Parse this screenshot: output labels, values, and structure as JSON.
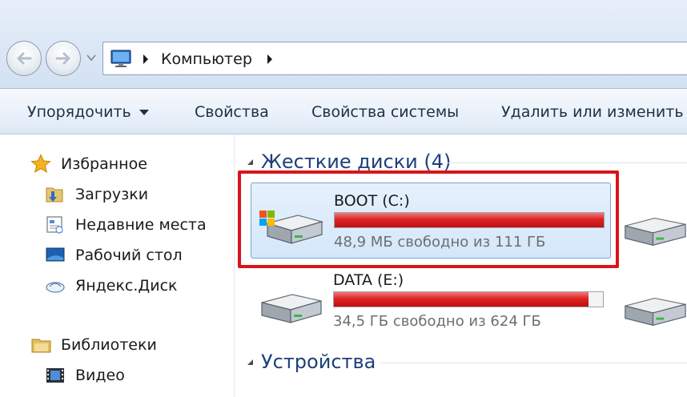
{
  "address": {
    "crumb": "Компьютер"
  },
  "toolbar": {
    "organize_label": "Упорядочить",
    "properties_label": "Свойства",
    "system_properties_label": "Свойства системы",
    "uninstall_label": "Удалить или изменить п"
  },
  "navigation": {
    "favorites_label": "Избранное",
    "favorites_items": [
      "Загрузки",
      "Недавние места",
      "Рабочий стол",
      "Яндекс.Диск"
    ],
    "libraries_label": "Библиотеки",
    "libraries_items": [
      "Видео"
    ]
  },
  "content": {
    "hard_disks_header": "Жесткие диски (4)",
    "devices_header": "Устройства",
    "drives": [
      {
        "name": "BOOT (C:)",
        "free_text": "48,9 МБ свободно из 111 ГБ",
        "used_fraction": 0.9996,
        "selected": true
      },
      {
        "name": "DATA (E:)",
        "free_text": "34,5 ГБ свободно из 624 ГБ",
        "used_fraction": 0.945,
        "selected": false
      }
    ]
  },
  "colors": {
    "highlight_border": "#d9141a",
    "usage_bar": "#dd2424",
    "group_header": "#1e3f7a"
  }
}
